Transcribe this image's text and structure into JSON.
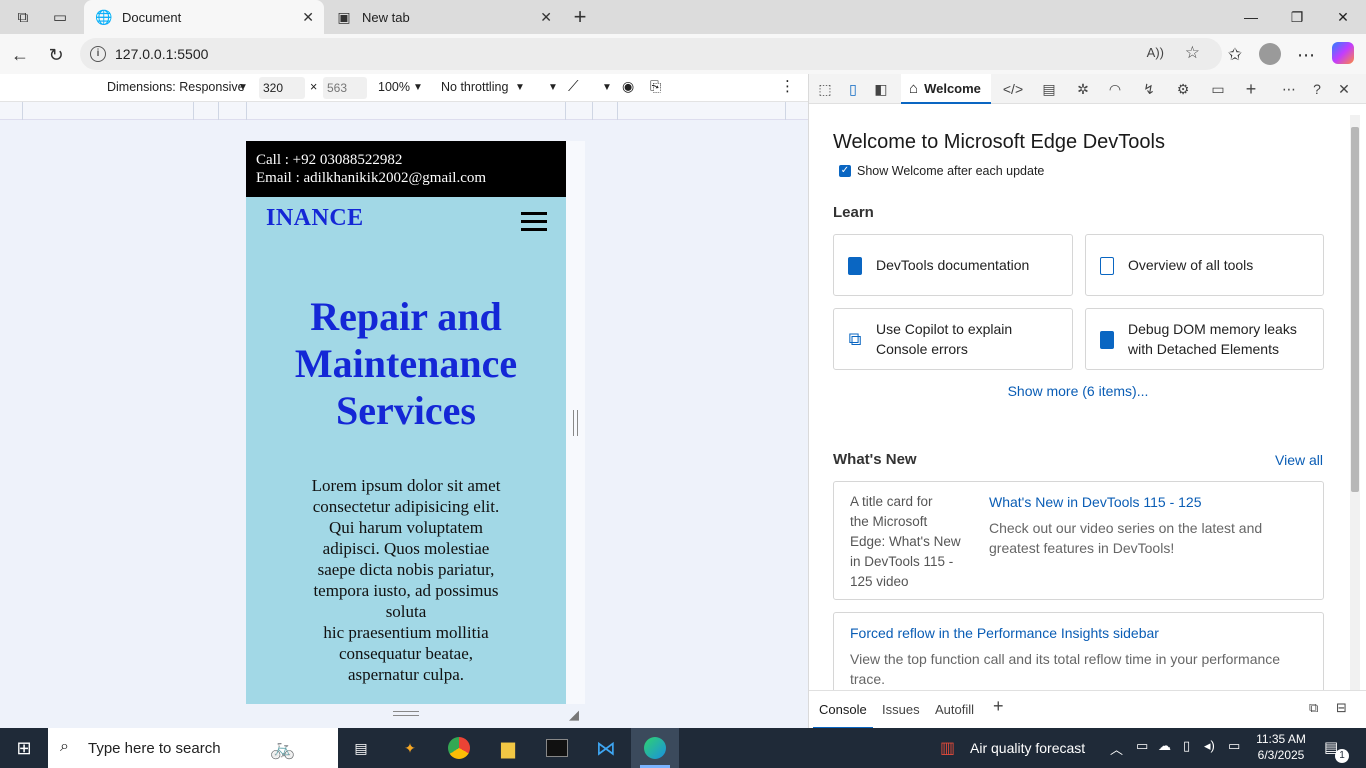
{
  "browser": {
    "tabs": [
      {
        "label": "Document",
        "active": true
      },
      {
        "label": "New tab",
        "active": false
      }
    ],
    "url": "127.0.0.1:5500"
  },
  "device_toolbar": {
    "dimensions_label": "Dimensions: Responsive",
    "width": "320",
    "height": "563",
    "zoom": "100%",
    "throttling": "No throttling"
  },
  "page": {
    "call": "Call : +92 03088522982",
    "email": "Email : adilkhanikik2002@gmail.com",
    "brand": "INANCE",
    "hero_lines": [
      "Repair and",
      "Maintenance",
      "Services"
    ],
    "lorem_lines": [
      "Lorem ipsum dolor sit amet",
      "consectetur adipisicing elit.",
      "Qui harum voluptatem",
      "adipisci. Quos molestiae",
      "saepe dicta nobis pariatur,",
      "tempora iusto, ad possimus",
      "soluta",
      "hic praesentium mollitia",
      "consequatur beatae,",
      "aspernatur culpa."
    ]
  },
  "devtools": {
    "welcome_tab": "Welcome",
    "title": "Welcome to Microsoft Edge DevTools",
    "show_welcome": "Show Welcome after each update",
    "learn_heading": "Learn",
    "cards": [
      {
        "label_lines": [
          "DevTools documentation"
        ]
      },
      {
        "label_lines": [
          "Overview of all tools"
        ]
      },
      {
        "label_lines": [
          "Use Copilot to explain",
          "Console errors"
        ]
      },
      {
        "label_lines": [
          "Debug DOM memory leaks",
          "with Detached Elements"
        ]
      }
    ],
    "show_more": "Show more (6 items)...",
    "whats_new_heading": "What's New",
    "view_all": "View all",
    "news": [
      {
        "img_alt_lines": [
          "A title card for",
          "the Microsoft",
          "Edge: What's New",
          "in DevTools 115 -",
          "125 video"
        ],
        "title": "What's New in DevTools 115 - 125",
        "desc_lines": [
          "Check out our video series on the latest and",
          "greatest features in DevTools!"
        ]
      },
      {
        "title": "Forced reflow in the Performance Insights sidebar",
        "desc_lines": [
          "View the top function call and its total reflow time in your performance",
          "trace."
        ]
      }
    ],
    "bottom_tabs": [
      "Console",
      "Issues",
      "Autofill"
    ]
  },
  "taskbar": {
    "search_placeholder": "Type here to search",
    "weather": "Air quality forecast",
    "time": "11:35 AM",
    "date": "6/3/2025",
    "notif_count": "1"
  },
  "colors": {
    "mobile_bg": "#a2d8e6",
    "brand_blue": "#1427d6",
    "link_blue": "#0a5db5",
    "taskbar": "#1f2a38"
  }
}
